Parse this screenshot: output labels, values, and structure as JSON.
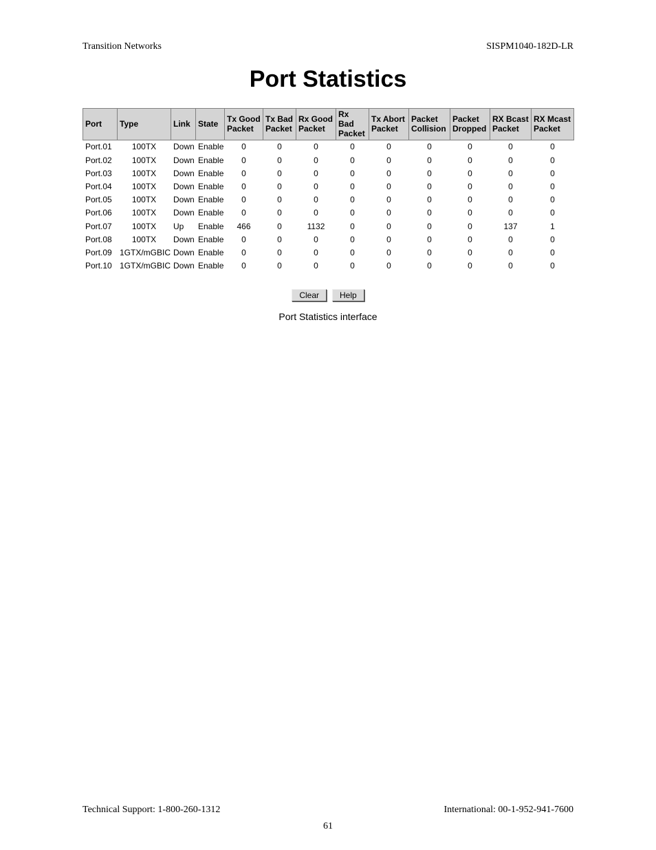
{
  "header": {
    "left": "Transition Networks",
    "right": "SISPM1040-182D-LR"
  },
  "title": "Port Statistics",
  "table": {
    "columns": [
      "Port",
      "Type",
      "Link",
      "State",
      "Tx Good Packet",
      "Tx Bad Packet",
      "Rx Good Packet",
      "Rx Bad Packet",
      "Tx Abort Packet",
      "Packet Collision",
      "Packet Dropped",
      "RX Bcast Packet",
      "RX Mcast Packet"
    ],
    "rows": [
      {
        "port": "Port.01",
        "type": "100TX",
        "link": "Down",
        "state": "Enable",
        "txg": 0,
        "txb": 0,
        "rxg": 0,
        "rxb": 0,
        "txa": 0,
        "pc": 0,
        "pd": 0,
        "rxbc": 0,
        "rxmc": 0
      },
      {
        "port": "Port.02",
        "type": "100TX",
        "link": "Down",
        "state": "Enable",
        "txg": 0,
        "txb": 0,
        "rxg": 0,
        "rxb": 0,
        "txa": 0,
        "pc": 0,
        "pd": 0,
        "rxbc": 0,
        "rxmc": 0
      },
      {
        "port": "Port.03",
        "type": "100TX",
        "link": "Down",
        "state": "Enable",
        "txg": 0,
        "txb": 0,
        "rxg": 0,
        "rxb": 0,
        "txa": 0,
        "pc": 0,
        "pd": 0,
        "rxbc": 0,
        "rxmc": 0
      },
      {
        "port": "Port.04",
        "type": "100TX",
        "link": "Down",
        "state": "Enable",
        "txg": 0,
        "txb": 0,
        "rxg": 0,
        "rxb": 0,
        "txa": 0,
        "pc": 0,
        "pd": 0,
        "rxbc": 0,
        "rxmc": 0
      },
      {
        "port": "Port.05",
        "type": "100TX",
        "link": "Down",
        "state": "Enable",
        "txg": 0,
        "txb": 0,
        "rxg": 0,
        "rxb": 0,
        "txa": 0,
        "pc": 0,
        "pd": 0,
        "rxbc": 0,
        "rxmc": 0
      },
      {
        "port": "Port.06",
        "type": "100TX",
        "link": "Down",
        "state": "Enable",
        "txg": 0,
        "txb": 0,
        "rxg": 0,
        "rxb": 0,
        "txa": 0,
        "pc": 0,
        "pd": 0,
        "rxbc": 0,
        "rxmc": 0
      },
      {
        "port": "Port.07",
        "type": "100TX",
        "link": "Up",
        "state": "Enable",
        "txg": 466,
        "txb": 0,
        "rxg": 1132,
        "rxb": 0,
        "txa": 0,
        "pc": 0,
        "pd": 0,
        "rxbc": 137,
        "rxmc": 1
      },
      {
        "port": "Port.08",
        "type": "100TX",
        "link": "Down",
        "state": "Enable",
        "txg": 0,
        "txb": 0,
        "rxg": 0,
        "rxb": 0,
        "txa": 0,
        "pc": 0,
        "pd": 0,
        "rxbc": 0,
        "rxmc": 0
      },
      {
        "port": "Port.09",
        "type": "1GTX/mGBIC",
        "link": "Down",
        "state": "Enable",
        "txg": 0,
        "txb": 0,
        "rxg": 0,
        "rxb": 0,
        "txa": 0,
        "pc": 0,
        "pd": 0,
        "rxbc": 0,
        "rxmc": 0
      },
      {
        "port": "Port.10",
        "type": "1GTX/mGBIC",
        "link": "Down",
        "state": "Enable",
        "txg": 0,
        "txb": 0,
        "rxg": 0,
        "rxb": 0,
        "txa": 0,
        "pc": 0,
        "pd": 0,
        "rxbc": 0,
        "rxmc": 0
      }
    ]
  },
  "buttons": {
    "clear": "Clear",
    "help": "Help"
  },
  "caption": "Port Statistics interface",
  "footer": {
    "left": "Technical Support: 1-800-260-1312",
    "right": "International: 00-1-952-941-7600"
  },
  "page_number": "61"
}
